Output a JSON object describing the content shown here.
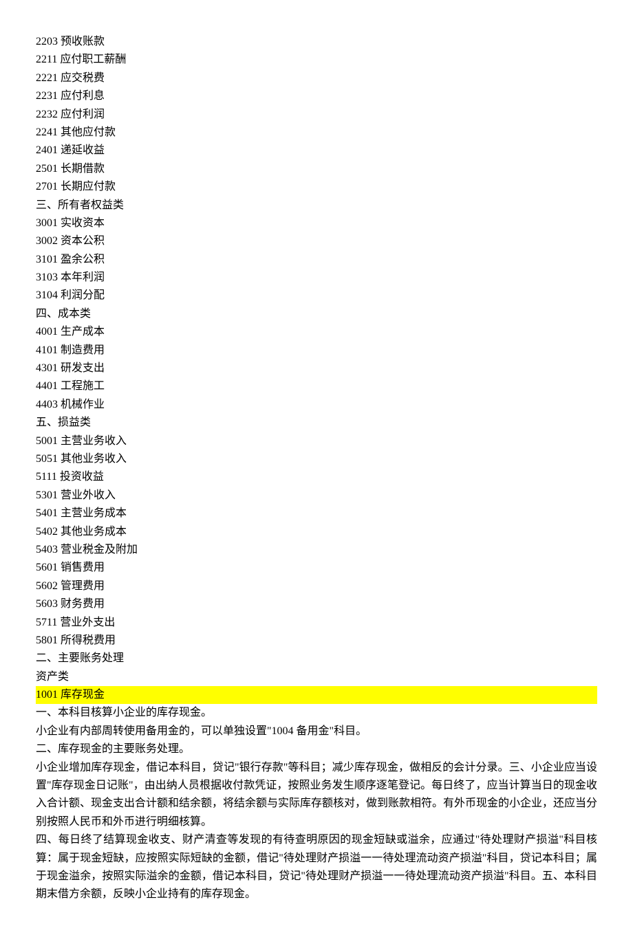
{
  "lines": [
    "2203 预收账款",
    "2211 应付职工薪酬",
    "2221 应交税费",
    "2231 应付利息",
    "2232 应付利润",
    "2241 其他应付款",
    "2401 递延收益",
    "2501 长期借款",
    "2701 长期应付款",
    "三、所有者权益类",
    "3001 实收资本",
    "3002 资本公积",
    "3101 盈余公积",
    "3103 本年利润",
    "3104 利润分配",
    "四、成本类",
    "4001 生产成本",
    "4101 制造费用",
    "4301 研发支出",
    "4401 工程施工",
    "4403 机械作业",
    "五、损益类",
    "5001 主营业务收入",
    "5051 其他业务收入",
    "5111 投资收益",
    "5301 营业外收入",
    "5401 主营业务成本",
    "5402 其他业务成本",
    "5403 营业税金及附加",
    "5601 销售费用",
    "5602 管理费用",
    "5603 财务费用",
    "5711 营业外支出",
    "5801 所得税费用",
    "二、主要账务处理",
    "资产类"
  ],
  "highlight": "1001 库存现金",
  "after": [
    "一、本科目核算小企业的库存现金。",
    "小企业有内部周转使用备用金的，可以单独设置\"1004 备用金\"科目。",
    "二、库存现金的主要账务处理。"
  ],
  "para1": "小企业增加库存现金，借记本科目，贷记\"银行存款\"等科目；减少库存现金，做相反的会计分录。三、小企业应当设置\"库存现金日记账\"，由出纳人员根据收付款凭证，按照业务发生顺序逐笔登记。每日终了，应当计算当日的现金收入合计额、现金支出合计额和结余额，将结余额与实际库存额核对，做到账款相符。有外币现金的小企业，还应当分别按照人民币和外币进行明细核算。",
  "para2": "四、每日终了结算现金收支、财产清查等发现的有待查明原因的现金短缺或溢余，应通过\"待处理财产损溢\"科目核算：属于现金短缺，应按照实际短缺的金额，借记\"待处理财产损溢一一待处理流动资产损溢\"科目，贷记本科目；属于现金溢余，按照实际溢余的金额，借记本科目，贷记\"待处理财产损溢一一待处理流动资产损溢\"科目。五、本科目期末借方余额，反映小企业持有的库存现金。"
}
